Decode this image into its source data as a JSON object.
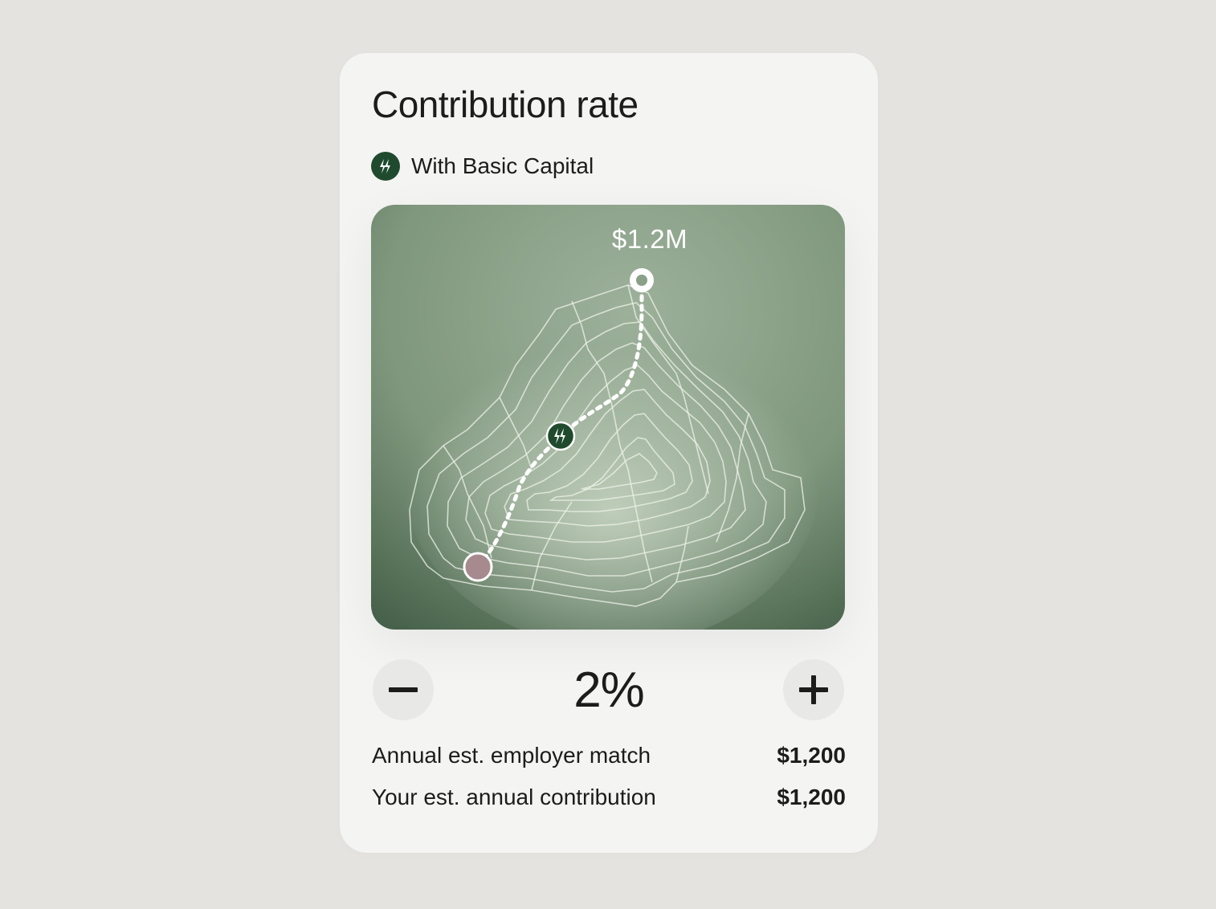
{
  "card": {
    "title": "Contribution rate",
    "brand": {
      "label": "With Basic Capital",
      "icon": "lightning-bolt-icon",
      "color": "#1f4a2e"
    }
  },
  "visual": {
    "goal_label": "$1.2M",
    "icons": [
      "goal-marker-icon",
      "lightning-bolt-icon",
      "start-marker-icon"
    ],
    "colors": {
      "background": "#8fa58c",
      "start_marker": "#a68a8e",
      "brand": "#1f4a2e"
    }
  },
  "stepper": {
    "value": "2%",
    "decrement_icon": "minus-icon",
    "increment_icon": "plus-icon"
  },
  "estimates": [
    {
      "label": "Annual est. employer match",
      "value": "$1,200"
    },
    {
      "label": "Your est. annual contribution",
      "value": "$1,200"
    }
  ]
}
